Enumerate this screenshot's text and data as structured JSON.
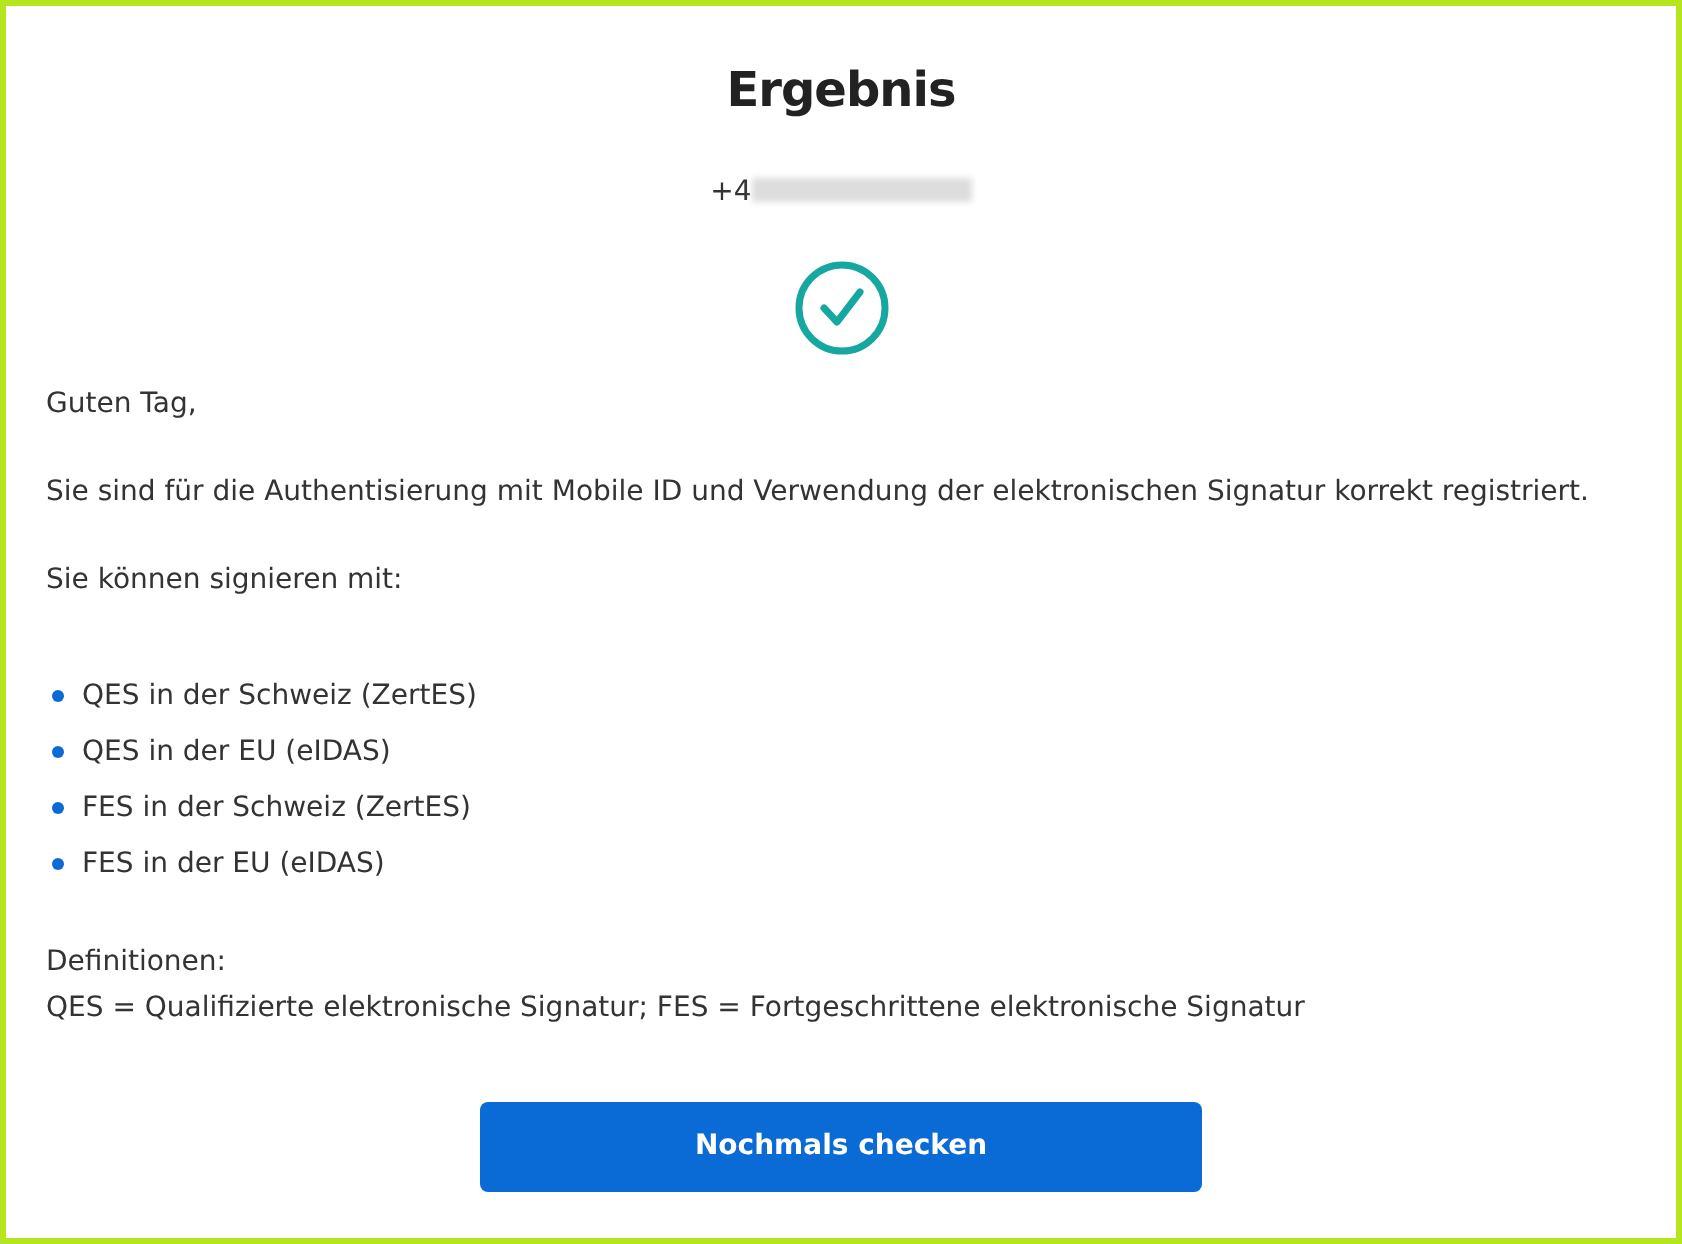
{
  "title": "Ergebnis",
  "phone": {
    "visible": "+4",
    "redacted": true
  },
  "status": {
    "kind": "success"
  },
  "greeting": "Guten Tag,",
  "message": "Sie sind für die Authentisierung mit Mobile ID und Verwendung der elektronischen Signatur korrekt registriert.",
  "list_intro": "Sie können signieren mit:",
  "signatures": [
    "QES in der Schweiz (ZertES)",
    "QES in der EU (eIDAS)",
    "FES in der Schweiz (ZertES)",
    "FES in der EU (eIDAS)"
  ],
  "definitions": {
    "heading": "Definitionen:",
    "text": "QES = Qualifizierte elektronische Signatur; FES = Fortgeschrittene elektronische Signatur"
  },
  "button": "Nochmals checken"
}
